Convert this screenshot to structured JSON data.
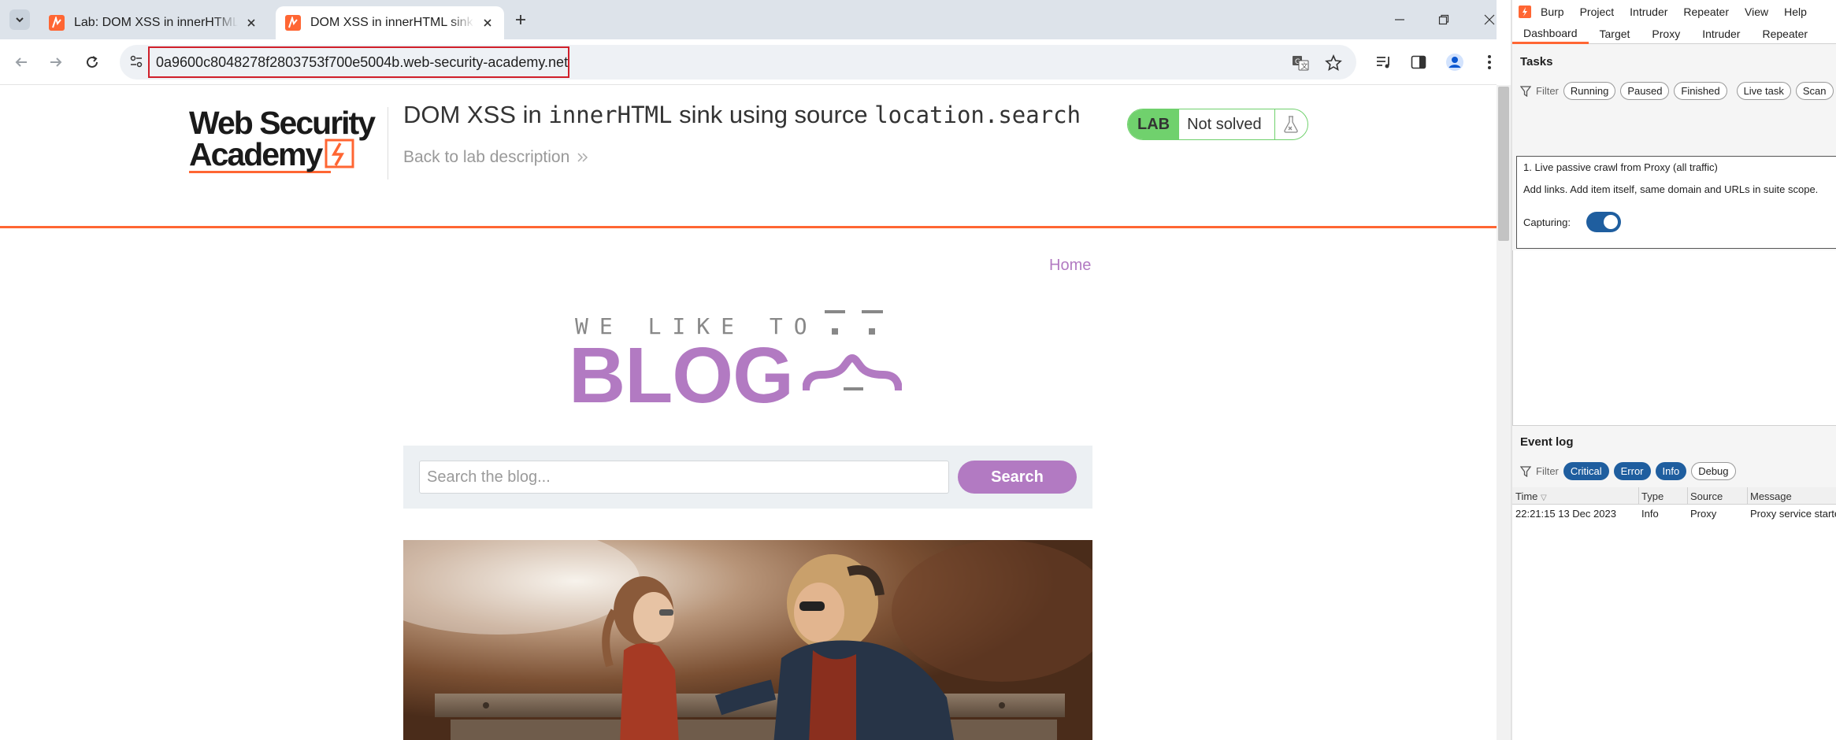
{
  "browser": {
    "tabs": [
      {
        "title": "Lab: DOM XSS in innerHTML sink using source location.search",
        "active": false
      },
      {
        "title": "DOM XSS in innerHTML sink using source location.search",
        "active": true
      }
    ],
    "url": "0a9600c8048278f2803753f700e5004b.web-security-academy.net"
  },
  "lab": {
    "logo_line1": "Web Security",
    "logo_line2": "Academy",
    "title_prefix": "DOM XSS in ",
    "title_code1": "innerHTML",
    "title_middle": " sink using source ",
    "title_code2": "location.search",
    "back_link": "Back to lab description",
    "badge": "LAB",
    "status": "Not solved"
  },
  "blog": {
    "nav_home": "Home",
    "tagline": "WE LIKE TO",
    "word": "BLOG",
    "search_placeholder": "Search the blog...",
    "search_button": "Search"
  },
  "burp": {
    "menu": [
      "Burp",
      "Project",
      "Intruder",
      "Repeater",
      "View",
      "Help"
    ],
    "tabs": [
      "Dashboard",
      "Target",
      "Proxy",
      "Intruder",
      "Repeater"
    ],
    "active_tab": "Dashboard",
    "tasks": {
      "title": "Tasks",
      "filter_label": "Filter",
      "filters": [
        "Running",
        "Paused",
        "Finished",
        "Live task",
        "Scan"
      ],
      "task_title": "1. Live passive crawl from Proxy (all traffic)",
      "task_desc": "Add links. Add item itself, same domain and URLs in suite scope.",
      "capturing_label": "Capturing:"
    },
    "event_log": {
      "title": "Event log",
      "filter_label": "Filter",
      "filters": [
        "Critical",
        "Error",
        "Info",
        "Debug"
      ],
      "columns": [
        "Time",
        "Type",
        "Source",
        "Message"
      ],
      "rows": [
        {
          "time": "22:21:15 13 Dec 2023",
          "type": "Info",
          "source": "Proxy",
          "message": "Proxy service started"
        }
      ]
    }
  },
  "colors": {
    "accent": "#ff6633",
    "blog_purple": "#b27ac2",
    "lab_green": "#70d16d",
    "burp_blue": "#1f5e9f"
  }
}
